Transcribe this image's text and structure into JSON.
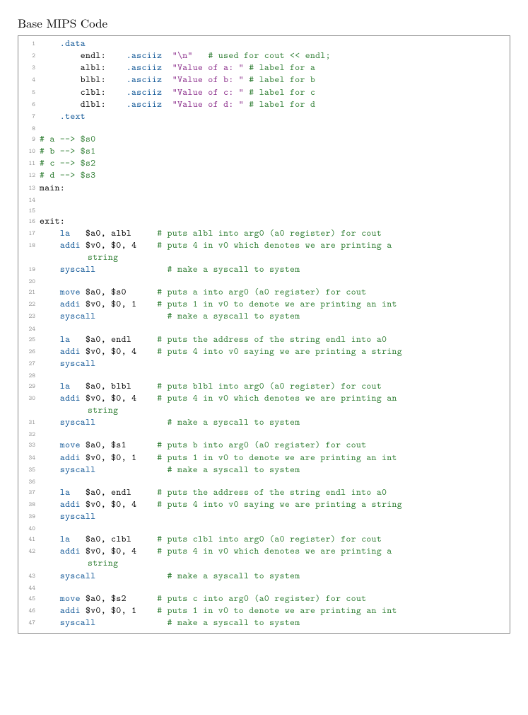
{
  "title": "Base MIPS Code",
  "lines": [
    {
      "n": 1,
      "segs": [
        [
          "    ",
          ""
        ],
        [
          ".data",
          "kw"
        ]
      ]
    },
    {
      "n": 2,
      "segs": [
        [
          "        endl:    ",
          ""
        ],
        [
          ".asciiz",
          "kw"
        ],
        [
          "  ",
          ""
        ],
        [
          "\"\\n\"",
          "str"
        ],
        [
          "   ",
          ""
        ],
        [
          "# used for cout << endl;",
          "cmt"
        ]
      ]
    },
    {
      "n": 3,
      "segs": [
        [
          "        albl:    ",
          ""
        ],
        [
          ".asciiz",
          "kw"
        ],
        [
          "  ",
          ""
        ],
        [
          "\"Value of a: \"",
          "str"
        ],
        [
          " ",
          ""
        ],
        [
          "# label for a",
          "cmt"
        ]
      ]
    },
    {
      "n": 4,
      "segs": [
        [
          "        blbl:    ",
          ""
        ],
        [
          ".asciiz",
          "kw"
        ],
        [
          "  ",
          ""
        ],
        [
          "\"Value of b: \"",
          "str"
        ],
        [
          " ",
          ""
        ],
        [
          "# label for b",
          "cmt"
        ]
      ]
    },
    {
      "n": 5,
      "segs": [
        [
          "        clbl:    ",
          ""
        ],
        [
          ".asciiz",
          "kw"
        ],
        [
          "  ",
          ""
        ],
        [
          "\"Value of c: \"",
          "str"
        ],
        [
          " ",
          ""
        ],
        [
          "# label for c",
          "cmt"
        ]
      ]
    },
    {
      "n": 6,
      "segs": [
        [
          "        dlbl:    ",
          ""
        ],
        [
          ".asciiz",
          "kw"
        ],
        [
          "  ",
          ""
        ],
        [
          "\"Value of d: \"",
          "str"
        ],
        [
          " ",
          ""
        ],
        [
          "# label for d",
          "cmt"
        ]
      ]
    },
    {
      "n": 7,
      "segs": [
        [
          "    ",
          ""
        ],
        [
          ".text",
          "kw"
        ]
      ]
    },
    {
      "n": 8,
      "segs": [
        [
          "",
          ""
        ]
      ]
    },
    {
      "n": 9,
      "segs": [
        [
          "# a --> $s0",
          "cmt"
        ]
      ]
    },
    {
      "n": 10,
      "segs": [
        [
          "# b --> $s1",
          "cmt"
        ]
      ]
    },
    {
      "n": 11,
      "segs": [
        [
          "# c --> $s2",
          "cmt"
        ]
      ]
    },
    {
      "n": 12,
      "segs": [
        [
          "# d --> $s3",
          "cmt"
        ]
      ]
    },
    {
      "n": 13,
      "segs": [
        [
          "main:",
          ""
        ]
      ]
    },
    {
      "n": 14,
      "segs": [
        [
          "",
          ""
        ]
      ]
    },
    {
      "n": 15,
      "segs": [
        [
          "",
          ""
        ]
      ]
    },
    {
      "n": 16,
      "segs": [
        [
          "exit:",
          ""
        ]
      ]
    },
    {
      "n": 17,
      "segs": [
        [
          "    ",
          ""
        ],
        [
          "la",
          "kw"
        ],
        [
          "   $a0, albl     ",
          ""
        ],
        [
          "# puts albl into arg0 (a0 register) for cout",
          "cmt"
        ]
      ]
    },
    {
      "n": 18,
      "segs": [
        [
          "    ",
          ""
        ],
        [
          "addi",
          "kw"
        ],
        [
          " $v0, $0, 4    ",
          ""
        ],
        [
          "# puts 4 in v0 which denotes we are printing a",
          "cmt"
        ]
      ],
      "wrap": [
        [
          "string",
          "cmt"
        ]
      ]
    },
    {
      "n": 19,
      "segs": [
        [
          "    ",
          ""
        ],
        [
          "syscall",
          "kw"
        ],
        [
          "              ",
          ""
        ],
        [
          "# make a syscall to system",
          "cmt"
        ]
      ]
    },
    {
      "n": 20,
      "segs": [
        [
          "",
          ""
        ]
      ]
    },
    {
      "n": 21,
      "segs": [
        [
          "    ",
          ""
        ],
        [
          "move",
          "kw"
        ],
        [
          " $a0, $s0      ",
          ""
        ],
        [
          "# puts a into arg0 (a0 register) for cout",
          "cmt"
        ]
      ]
    },
    {
      "n": 22,
      "segs": [
        [
          "    ",
          ""
        ],
        [
          "addi",
          "kw"
        ],
        [
          " $v0, $0, 1    ",
          ""
        ],
        [
          "# puts 1 in v0 to denote we are printing an int",
          "cmt"
        ]
      ]
    },
    {
      "n": 23,
      "segs": [
        [
          "    ",
          ""
        ],
        [
          "syscall",
          "kw"
        ],
        [
          "              ",
          ""
        ],
        [
          "# make a syscall to system",
          "cmt"
        ]
      ]
    },
    {
      "n": 24,
      "segs": [
        [
          "",
          ""
        ]
      ]
    },
    {
      "n": 25,
      "segs": [
        [
          "    ",
          ""
        ],
        [
          "la",
          "kw"
        ],
        [
          "   $a0, endl     ",
          ""
        ],
        [
          "# puts the address of the string endl into a0",
          "cmt"
        ]
      ]
    },
    {
      "n": 26,
      "segs": [
        [
          "    ",
          ""
        ],
        [
          "addi",
          "kw"
        ],
        [
          " $v0, $0, 4    ",
          ""
        ],
        [
          "# puts 4 into v0 saying we are printing a string",
          "cmt"
        ]
      ]
    },
    {
      "n": 27,
      "segs": [
        [
          "    ",
          ""
        ],
        [
          "syscall",
          "kw"
        ]
      ]
    },
    {
      "n": 28,
      "segs": [
        [
          "",
          ""
        ]
      ]
    },
    {
      "n": 29,
      "segs": [
        [
          "    ",
          ""
        ],
        [
          "la",
          "kw"
        ],
        [
          "   $a0, blbl     ",
          ""
        ],
        [
          "# puts blbl into arg0 (a0 register) for cout",
          "cmt"
        ]
      ]
    },
    {
      "n": 30,
      "segs": [
        [
          "    ",
          ""
        ],
        [
          "addi",
          "kw"
        ],
        [
          " $v0, $0, 4    ",
          ""
        ],
        [
          "# puts 4 in v0 which denotes we are printing an",
          "cmt"
        ]
      ],
      "wrap": [
        [
          "string",
          "cmt"
        ]
      ]
    },
    {
      "n": 31,
      "segs": [
        [
          "    ",
          ""
        ],
        [
          "syscall",
          "kw"
        ],
        [
          "              ",
          ""
        ],
        [
          "# make a syscall to system",
          "cmt"
        ]
      ]
    },
    {
      "n": 32,
      "segs": [
        [
          "",
          ""
        ]
      ]
    },
    {
      "n": 33,
      "segs": [
        [
          "    ",
          ""
        ],
        [
          "move",
          "kw"
        ],
        [
          " $a0, $s1      ",
          ""
        ],
        [
          "# puts b into arg0 (a0 register) for cout",
          "cmt"
        ]
      ]
    },
    {
      "n": 34,
      "segs": [
        [
          "    ",
          ""
        ],
        [
          "addi",
          "kw"
        ],
        [
          " $v0, $0, 1    ",
          ""
        ],
        [
          "# puts 1 in v0 to denote we are printing an int",
          "cmt"
        ]
      ]
    },
    {
      "n": 35,
      "segs": [
        [
          "    ",
          ""
        ],
        [
          "syscall",
          "kw"
        ],
        [
          "              ",
          ""
        ],
        [
          "# make a syscall to system",
          "cmt"
        ]
      ]
    },
    {
      "n": 36,
      "segs": [
        [
          "",
          ""
        ]
      ]
    },
    {
      "n": 37,
      "segs": [
        [
          "    ",
          ""
        ],
        [
          "la",
          "kw"
        ],
        [
          "   $a0, endl     ",
          ""
        ],
        [
          "# puts the address of the string endl into a0",
          "cmt"
        ]
      ]
    },
    {
      "n": 38,
      "segs": [
        [
          "    ",
          ""
        ],
        [
          "addi",
          "kw"
        ],
        [
          " $v0, $0, 4    ",
          ""
        ],
        [
          "# puts 4 into v0 saying we are printing a string",
          "cmt"
        ]
      ]
    },
    {
      "n": 39,
      "segs": [
        [
          "    ",
          ""
        ],
        [
          "syscall",
          "kw"
        ]
      ]
    },
    {
      "n": 40,
      "segs": [
        [
          "",
          ""
        ]
      ]
    },
    {
      "n": 41,
      "segs": [
        [
          "    ",
          ""
        ],
        [
          "la",
          "kw"
        ],
        [
          "   $a0, clbl     ",
          ""
        ],
        [
          "# puts clbl into arg0 (a0 register) for cout",
          "cmt"
        ]
      ]
    },
    {
      "n": 42,
      "segs": [
        [
          "    ",
          ""
        ],
        [
          "addi",
          "kw"
        ],
        [
          " $v0, $0, 4    ",
          ""
        ],
        [
          "# puts 4 in v0 which denotes we are printing a",
          "cmt"
        ]
      ],
      "wrap": [
        [
          "string",
          "cmt"
        ]
      ]
    },
    {
      "n": 43,
      "segs": [
        [
          "    ",
          ""
        ],
        [
          "syscall",
          "kw"
        ],
        [
          "              ",
          ""
        ],
        [
          "# make a syscall to system",
          "cmt"
        ]
      ]
    },
    {
      "n": 44,
      "segs": [
        [
          "",
          ""
        ]
      ]
    },
    {
      "n": 45,
      "segs": [
        [
          "    ",
          ""
        ],
        [
          "move",
          "kw"
        ],
        [
          " $a0, $s2      ",
          ""
        ],
        [
          "# puts c into arg0 (a0 register) for cout",
          "cmt"
        ]
      ]
    },
    {
      "n": 46,
      "segs": [
        [
          "    ",
          ""
        ],
        [
          "addi",
          "kw"
        ],
        [
          " $v0, $0, 1    ",
          ""
        ],
        [
          "# puts 1 in v0 to denote we are printing an int",
          "cmt"
        ]
      ]
    },
    {
      "n": 47,
      "segs": [
        [
          "    ",
          ""
        ],
        [
          "syscall",
          "kw"
        ],
        [
          "              ",
          ""
        ],
        [
          "# make a syscall to system",
          "cmt"
        ]
      ]
    }
  ]
}
